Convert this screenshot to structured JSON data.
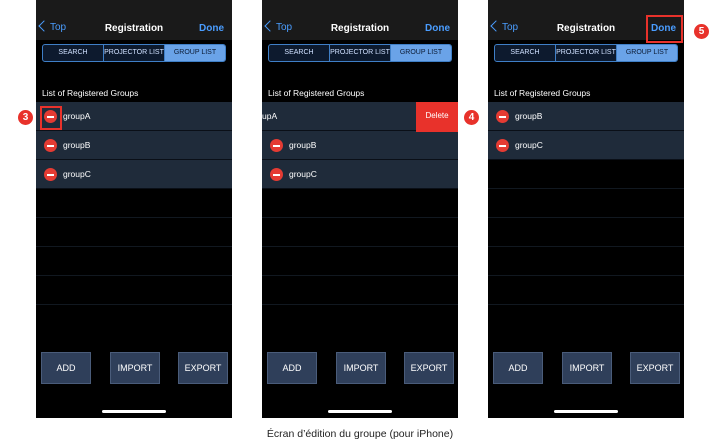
{
  "nav": {
    "back_label": "Top",
    "title": "Registration",
    "done_label": "Done"
  },
  "segments": [
    "SEARCH",
    "PROJECTOR LIST",
    "GROUP LIST"
  ],
  "list_heading": "List of Registered Groups",
  "screens": [
    {
      "groups": [
        "groupA",
        "groupB",
        "groupC"
      ]
    },
    {
      "groups": [
        "upA",
        "groupB",
        "groupC"
      ],
      "delete_label": "Delete"
    },
    {
      "groups": [
        "groupB",
        "groupC"
      ]
    }
  ],
  "buttons": {
    "add": "ADD",
    "import": "IMPORT",
    "export": "EXPORT"
  },
  "badges": [
    "3",
    "4",
    "5"
  ],
  "caption": "Écran d’édition du groupe (pour iPhone)",
  "colors": {
    "accent": "#4a9dff",
    "delete": "#e8322b",
    "segment_active": "#6aa3e8"
  }
}
